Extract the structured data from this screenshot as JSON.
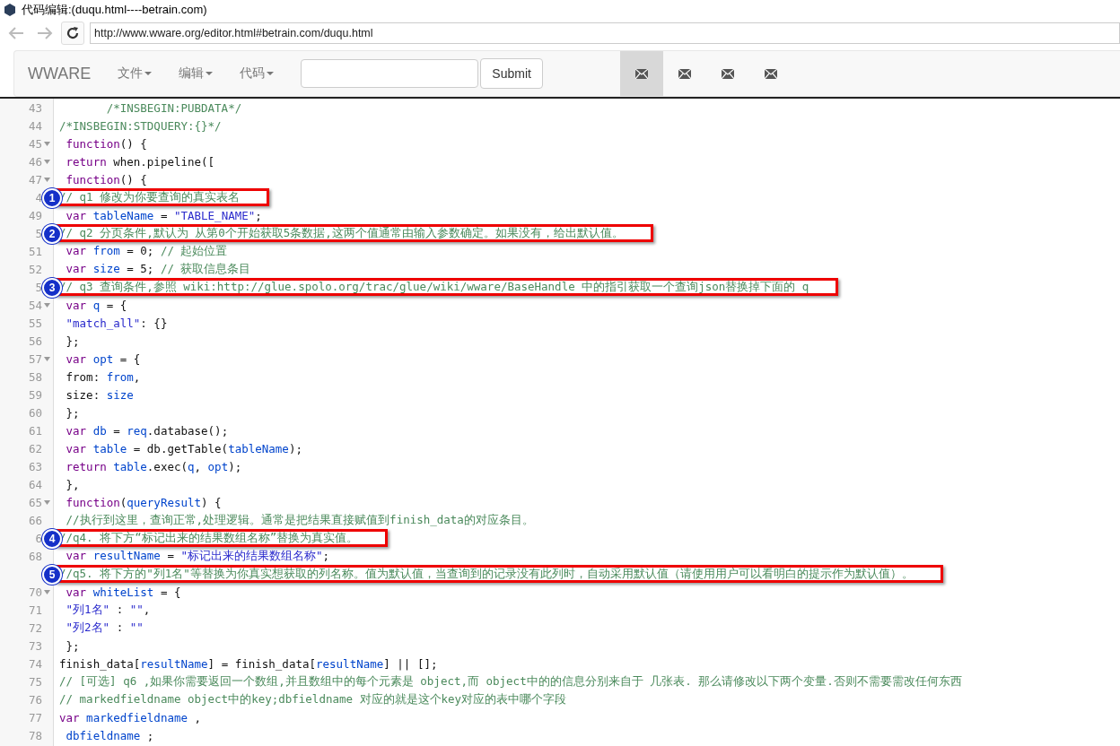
{
  "window": {
    "title": "代码编辑:(duqu.html----betrain.com)"
  },
  "browser": {
    "url": "http://www.wware.org/editor.html#betrain.com/duqu.html"
  },
  "navbar": {
    "brand": "WWARE",
    "menus": [
      {
        "label": "文件"
      },
      {
        "label": "编辑"
      },
      {
        "label": "代码"
      }
    ],
    "submit": "Submit",
    "mail_tabs": [
      {
        "selected": true
      },
      {
        "selected": false
      },
      {
        "selected": false
      },
      {
        "selected": false
      }
    ]
  },
  "editor": {
    "lines": [
      {
        "number": "43",
        "foldable": false,
        "highlighted": false,
        "tokens": [
          {
            "kind": "comment",
            "text": "       /*INSBEGIN:PUBDATA*/"
          }
        ]
      },
      {
        "number": "44",
        "foldable": false,
        "highlighted": false,
        "tokens": [
          {
            "kind": "comment",
            "text": "/*INSBEGIN:STDQUERY:{}*/"
          }
        ]
      },
      {
        "number": "45",
        "foldable": true,
        "highlighted": false,
        "tokens": [
          {
            "kind": "keyword",
            "text": " function"
          },
          {
            "kind": "plain",
            "text": "() {"
          }
        ]
      },
      {
        "number": "46",
        "foldable": true,
        "highlighted": false,
        "tokens": [
          {
            "kind": "keyword",
            "text": " return"
          },
          {
            "kind": "plain",
            "text": " when.pipeline(["
          }
        ]
      },
      {
        "number": "47",
        "foldable": true,
        "highlighted": false,
        "tokens": [
          {
            "kind": "keyword",
            "text": " function"
          },
          {
            "kind": "plain",
            "text": "() {"
          }
        ]
      },
      {
        "number": "4",
        "foldable": false,
        "highlighted": true,
        "marker": "1",
        "tokens": [
          {
            "kind": "comment",
            "text": "// q1 修改为你要查询的真实表名"
          }
        ]
      },
      {
        "number": "49",
        "foldable": false,
        "highlighted": false,
        "tokens": [
          {
            "kind": "keyword",
            "text": " var"
          },
          {
            "kind": "def",
            "text": " tableName"
          },
          {
            "kind": "plain",
            "text": " = "
          },
          {
            "kind": "string",
            "text": "\"TABLE_NAME\""
          },
          {
            "kind": "plain",
            "text": ";"
          }
        ]
      },
      {
        "number": "5",
        "foldable": false,
        "highlighted": true,
        "marker": "2",
        "tokens": [
          {
            "kind": "comment",
            "text": "// q2 分页条件,默认为 从第0个开始获取5条数据,这两个值通常由输入参数确定。如果没有，给出默认值。"
          }
        ]
      },
      {
        "number": "51",
        "foldable": false,
        "highlighted": false,
        "tokens": [
          {
            "kind": "keyword",
            "text": " var"
          },
          {
            "kind": "def",
            "text": " from"
          },
          {
            "kind": "plain",
            "text": " = 0; "
          },
          {
            "kind": "comment",
            "text": "// 起始位置"
          }
        ]
      },
      {
        "number": "52",
        "foldable": false,
        "highlighted": false,
        "tokens": [
          {
            "kind": "keyword",
            "text": " var"
          },
          {
            "kind": "def",
            "text": " size"
          },
          {
            "kind": "plain",
            "text": " = 5; "
          },
          {
            "kind": "comment",
            "text": "// 获取信息条目"
          }
        ]
      },
      {
        "number": "5",
        "foldable": false,
        "highlighted": true,
        "marker": "3",
        "tokens": [
          {
            "kind": "comment",
            "text": "// q3 查询条件,参照 wiki:http://glue.spolo.org/trac/glue/wiki/wware/BaseHandle 中的指引获取一个查询json替换掉下面的 q"
          }
        ]
      },
      {
        "number": "54",
        "foldable": true,
        "highlighted": false,
        "tokens": [
          {
            "kind": "keyword",
            "text": " var"
          },
          {
            "kind": "def",
            "text": " q"
          },
          {
            "kind": "plain",
            "text": " = {"
          }
        ]
      },
      {
        "number": "55",
        "foldable": false,
        "highlighted": false,
        "tokens": [
          {
            "kind": "string",
            "text": " \"match_all\""
          },
          {
            "kind": "plain",
            "text": ": {}"
          }
        ]
      },
      {
        "number": "56",
        "foldable": false,
        "highlighted": false,
        "tokens": [
          {
            "kind": "plain",
            "text": " };"
          }
        ]
      },
      {
        "number": "57",
        "foldable": true,
        "highlighted": false,
        "tokens": [
          {
            "kind": "keyword",
            "text": " var"
          },
          {
            "kind": "def",
            "text": " opt"
          },
          {
            "kind": "plain",
            "text": " = {"
          }
        ]
      },
      {
        "number": "58",
        "foldable": false,
        "highlighted": false,
        "tokens": [
          {
            "kind": "plain",
            "text": " from: "
          },
          {
            "kind": "def",
            "text": "from"
          },
          {
            "kind": "plain",
            "text": ","
          }
        ]
      },
      {
        "number": "59",
        "foldable": false,
        "highlighted": false,
        "tokens": [
          {
            "kind": "plain",
            "text": " size: "
          },
          {
            "kind": "def",
            "text": "size"
          }
        ]
      },
      {
        "number": "60",
        "foldable": false,
        "highlighted": false,
        "tokens": [
          {
            "kind": "plain",
            "text": " };"
          }
        ]
      },
      {
        "number": "61",
        "foldable": false,
        "highlighted": false,
        "tokens": [
          {
            "kind": "keyword",
            "text": " var"
          },
          {
            "kind": "def",
            "text": " db"
          },
          {
            "kind": "plain",
            "text": " = "
          },
          {
            "kind": "def",
            "text": "req"
          },
          {
            "kind": "plain",
            "text": ".database();"
          }
        ]
      },
      {
        "number": "62",
        "foldable": false,
        "highlighted": false,
        "tokens": [
          {
            "kind": "keyword",
            "text": " var"
          },
          {
            "kind": "def",
            "text": " table"
          },
          {
            "kind": "plain",
            "text": " = db.getTable("
          },
          {
            "kind": "def",
            "text": "tableName"
          },
          {
            "kind": "plain",
            "text": ");"
          }
        ]
      },
      {
        "number": "63",
        "foldable": false,
        "highlighted": false,
        "tokens": [
          {
            "kind": "keyword",
            "text": " return"
          },
          {
            "kind": "def",
            "text": " table"
          },
          {
            "kind": "plain",
            "text": ".exec("
          },
          {
            "kind": "def",
            "text": "q"
          },
          {
            "kind": "plain",
            "text": ", "
          },
          {
            "kind": "def",
            "text": "opt"
          },
          {
            "kind": "plain",
            "text": ");"
          }
        ]
      },
      {
        "number": "64",
        "foldable": false,
        "highlighted": false,
        "tokens": [
          {
            "kind": "plain",
            "text": " },"
          }
        ]
      },
      {
        "number": "65",
        "foldable": true,
        "highlighted": false,
        "tokens": [
          {
            "kind": "keyword",
            "text": " function"
          },
          {
            "kind": "plain",
            "text": "("
          },
          {
            "kind": "def",
            "text": "queryResult"
          },
          {
            "kind": "plain",
            "text": ") {"
          }
        ]
      },
      {
        "number": "66",
        "foldable": false,
        "highlighted": false,
        "tokens": [
          {
            "kind": "comment",
            "text": " //执行到这里，查询正常,处理逻辑。通常是把结果直接赋值到finish_data的对应条目。"
          }
        ]
      },
      {
        "number": "6",
        "foldable": false,
        "highlighted": true,
        "marker": "4",
        "tokens": [
          {
            "kind": "comment",
            "text": "//q4. 将下方“标记出来的结果数组名称”替换为真实值。"
          }
        ]
      },
      {
        "number": "68",
        "foldable": false,
        "highlighted": false,
        "tokens": [
          {
            "kind": "keyword",
            "text": " var"
          },
          {
            "kind": "def",
            "text": " resultName"
          },
          {
            "kind": "plain",
            "text": " = "
          },
          {
            "kind": "string",
            "text": "\"标记出来的结果数组名称\""
          },
          {
            "kind": "plain",
            "text": ";"
          }
        ]
      },
      {
        "foldable": false,
        "highlighted": true,
        "marker": "5",
        "tokens": [
          {
            "kind": "comment",
            "text": "//q5. 将下方的\"列1名\"等替换为你真实想获取的列名称。值为默认值，当查询到的记录没有此列时，自动采用默认值（请使用用户可以看明白的提示作为默认值）。"
          }
        ]
      },
      {
        "number": "70",
        "foldable": true,
        "highlighted": false,
        "tokens": [
          {
            "kind": "keyword",
            "text": " var"
          },
          {
            "kind": "def",
            "text": " whiteList"
          },
          {
            "kind": "plain",
            "text": " = {"
          }
        ]
      },
      {
        "number": "71",
        "foldable": false,
        "highlighted": false,
        "tokens": [
          {
            "kind": "string",
            "text": " \"列1名\""
          },
          {
            "kind": "plain",
            "text": " : "
          },
          {
            "kind": "string",
            "text": "\"\""
          },
          {
            "kind": "plain",
            "text": ","
          }
        ]
      },
      {
        "number": "72",
        "foldable": false,
        "highlighted": false,
        "tokens": [
          {
            "kind": "string",
            "text": " \"列2名\""
          },
          {
            "kind": "plain",
            "text": " : "
          },
          {
            "kind": "string",
            "text": "\"\""
          }
        ]
      },
      {
        "number": "73",
        "foldable": false,
        "highlighted": false,
        "tokens": [
          {
            "kind": "plain",
            "text": " };"
          }
        ]
      },
      {
        "number": "74",
        "foldable": false,
        "highlighted": false,
        "tokens": [
          {
            "kind": "plain",
            "text": "finish_data["
          },
          {
            "kind": "def",
            "text": "resultName"
          },
          {
            "kind": "plain",
            "text": "] = finish_data["
          },
          {
            "kind": "def",
            "text": "resultName"
          },
          {
            "kind": "plain",
            "text": "] || [];"
          }
        ]
      },
      {
        "number": "75",
        "foldable": false,
        "highlighted": false,
        "tokens": [
          {
            "kind": "comment",
            "text": "// [可选] q6 ,如果你需要返回一个数组,并且数组中的每个元素是 object,而 object中的的信息分别来自于 几张表. 那么请修改以下两个变量.否则不需要需改任何东西"
          }
        ]
      },
      {
        "number": "76",
        "foldable": false,
        "highlighted": false,
        "tokens": [
          {
            "kind": "comment",
            "text": "// markedfieldname object中的key;dbfieldname 对应的就是这个key对应的表中哪个字段"
          }
        ]
      },
      {
        "number": "77",
        "foldable": false,
        "highlighted": false,
        "tokens": [
          {
            "kind": "keyword",
            "text": "var"
          },
          {
            "kind": "def",
            "text": " markedfieldname"
          },
          {
            "kind": "plain",
            "text": " ,"
          }
        ]
      },
      {
        "number": "78",
        "foldable": false,
        "highlighted": false,
        "tokens": [
          {
            "kind": "def",
            "text": " dbfieldname"
          },
          {
            "kind": "plain",
            "text": " ;"
          }
        ]
      }
    ]
  }
}
